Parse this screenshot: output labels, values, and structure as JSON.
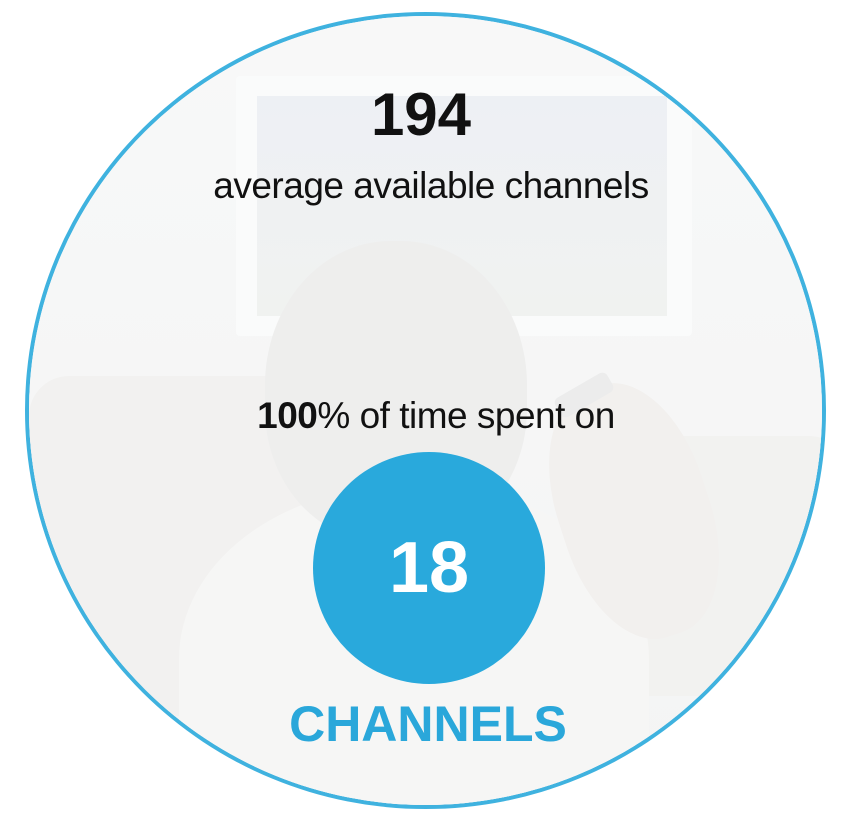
{
  "stats": {
    "available_channels_value": "194",
    "available_channels_label": "average available channels",
    "time_percent": "100",
    "time_percent_suffix": "% of time spent on",
    "channels_value": "18",
    "channels_label": "CHANNELS"
  },
  "colors": {
    "accent": "#29a9dc",
    "ring": "#3fb2df",
    "text": "#111111"
  },
  "background": {
    "description_icon": "person-watching-tv-photo"
  }
}
